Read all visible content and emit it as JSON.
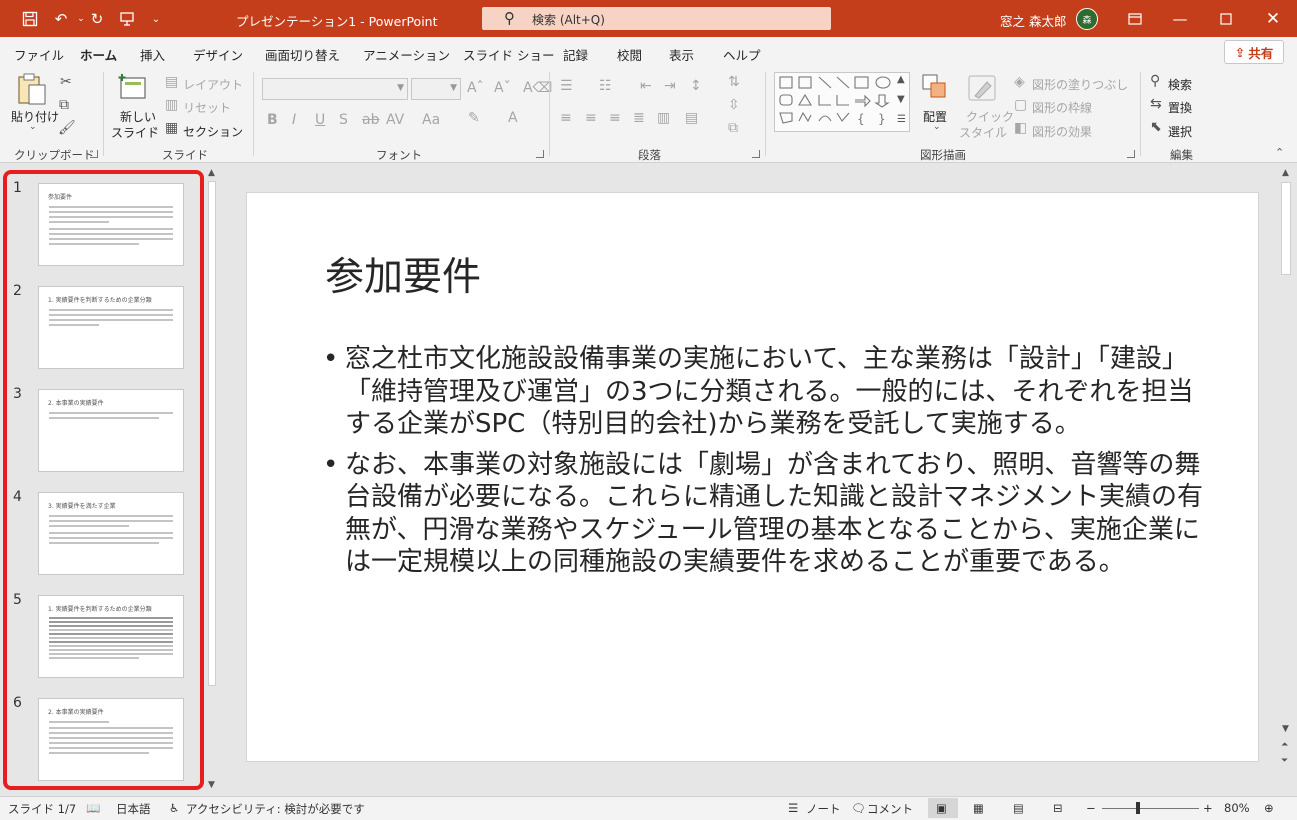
{
  "titlebar": {
    "title": "プレゼンテーション1  -  PowerPoint",
    "search_placeholder": "検索 (Alt+Q)",
    "user_name": "窓之 森太郎",
    "avatar_text": "森"
  },
  "tabs": [
    "ファイル",
    "ホーム",
    "挿入",
    "デザイン",
    "画面切り替え",
    "アニメーション",
    "スライド ショー",
    "記録",
    "校閲",
    "表示",
    "ヘルプ"
  ],
  "share_label": "共有",
  "ribbon": {
    "clipboard": {
      "paste": "貼り付け",
      "label": "クリップボード"
    },
    "slides": {
      "new_slide_1": "新しい",
      "new_slide_2": "スライド",
      "layout": "レイアウト",
      "reset": "リセット",
      "section": "セクション",
      "label": "スライド"
    },
    "font": {
      "label": "フォント"
    },
    "paragraph": {
      "label": "段落"
    },
    "drawing": {
      "arrange": "配置",
      "quick_style_1": "クイック",
      "quick_style_2": "スタイル",
      "fill": "図形の塗りつぶし",
      "outline": "図形の枠線",
      "effects": "図形の効果",
      "label": "図形描画"
    },
    "editing": {
      "find": "検索",
      "replace": "置換",
      "select": "選択",
      "label": "編集"
    }
  },
  "thumbnails": [
    {
      "num": "1",
      "title": "参加要件"
    },
    {
      "num": "2",
      "title": "1. 実績要件を判断するための企業分類"
    },
    {
      "num": "3",
      "title": "2. 本事業の実績要件"
    },
    {
      "num": "4",
      "title": "3. 実績要件を満たす企業"
    },
    {
      "num": "5",
      "title": "1. 実績要件を判断するための企業分類"
    },
    {
      "num": "6",
      "title": "2. 本事業の実績要件"
    }
  ],
  "slide": {
    "title": "参加要件",
    "bullets": [
      "窓之杜市文化施設設備事業の実施において、主な業務は「設計」「建設」「維持管理及び運営」の3つに分類される。一般的には、それぞれを担当する企業がSPC（特別目的会社)から業務を受託して実施する。",
      "なお、本事業の対象施設には「劇場」が含まれており、照明、音響等の舞台設備が必要になる。これらに精通した知識と設計マネジメント実績の有無が、円滑な業務やスケジュール管理の基本となることから、実施企業には一定規模以上の同種施設の実績要件を求めることが重要である。"
    ]
  },
  "statusbar": {
    "slide_indicator": "スライド 1/7",
    "language": "日本語",
    "accessibility": "アクセシビリティ: 検討が必要です",
    "notes": "ノート",
    "comments": "コメント",
    "zoom": "80%"
  },
  "colors": {
    "accent": "#c43e1c",
    "highlight": "#e81e1e"
  }
}
